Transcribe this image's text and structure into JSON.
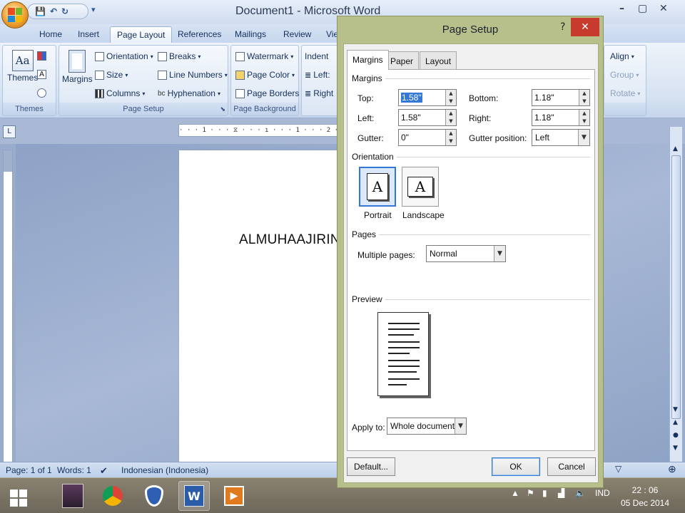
{
  "window": {
    "title": "Document1 - Microsoft Word",
    "minimize": "–",
    "restore": "▢",
    "close": "✕"
  },
  "quick_access": {
    "save": "💾",
    "undo": "↶",
    "redo": "↻",
    "more": "▾"
  },
  "ribbon_tabs": [
    {
      "label": "Home"
    },
    {
      "label": "Insert"
    },
    {
      "label": "Page Layout"
    },
    {
      "label": "References"
    },
    {
      "label": "Mailings"
    },
    {
      "label": "Review"
    },
    {
      "label": "Vie"
    }
  ],
  "ribbon": {
    "themes": {
      "button": "Themes",
      "group": "Themes"
    },
    "page_setup": {
      "margins": "Margins",
      "orientation": "Orientation",
      "size": "Size",
      "columns": "Columns",
      "breaks": "Breaks",
      "line_numbers": "Line Numbers",
      "hyphenation": "Hyphenation",
      "group": "Page Setup"
    },
    "page_background": {
      "watermark": "Watermark",
      "page_color": "Page Color",
      "page_borders": "Page Borders",
      "group": "Page Background"
    },
    "paragraph": {
      "indent": "Indent",
      "left": "Left:",
      "right": "Right"
    },
    "arrange": {
      "align": "Align",
      "group_btn": "Group",
      "rotate": "Rotate"
    }
  },
  "ruler": {
    "marks": "· · · 1 · · · ⧖ · · · ı · · · 1 · · · 2 · · ·"
  },
  "document": {
    "text": "ALMUHAAJIRIN"
  },
  "status_bar": {
    "page": "Page: 1 of 1",
    "words": "Words: 1",
    "language": "Indonesian (Indonesia)"
  },
  "dialog": {
    "title": "Page Setup",
    "help": "?",
    "close": "✕",
    "tabs": [
      {
        "label": "Margins"
      },
      {
        "label": "Paper"
      },
      {
        "label": "Layout"
      }
    ],
    "margins_section": "Margins",
    "top_label": "Top:",
    "top_value": "1.58\"",
    "bottom_label": "Bottom:",
    "bottom_value": "1.18\"",
    "left_label": "Left:",
    "left_value": "1.58\"",
    "right_label": "Right:",
    "right_value": "1.18\"",
    "gutter_label": "Gutter:",
    "gutter_value": "0\"",
    "gutter_position_label": "Gutter position:",
    "gutter_position_value": "Left",
    "orientation_section": "Orientation",
    "portrait": "Portrait",
    "landscape": "Landscape",
    "pages_section": "Pages",
    "multiple_pages_label": "Multiple pages:",
    "multiple_pages_value": "Normal",
    "preview_section": "Preview",
    "apply_to_label": "Apply to:",
    "apply_to_value": "Whole document",
    "default_button": "Default...",
    "ok_button": "OK",
    "cancel_button": "Cancel"
  },
  "taskbar": {
    "tray_lang": "IND",
    "time": "22 : 06",
    "date": "05 Dec 2014"
  },
  "colors": {
    "dialog_frame": "#b7c08b",
    "close_red": "#c73b2f",
    "selection_blue": "#3378d4"
  }
}
